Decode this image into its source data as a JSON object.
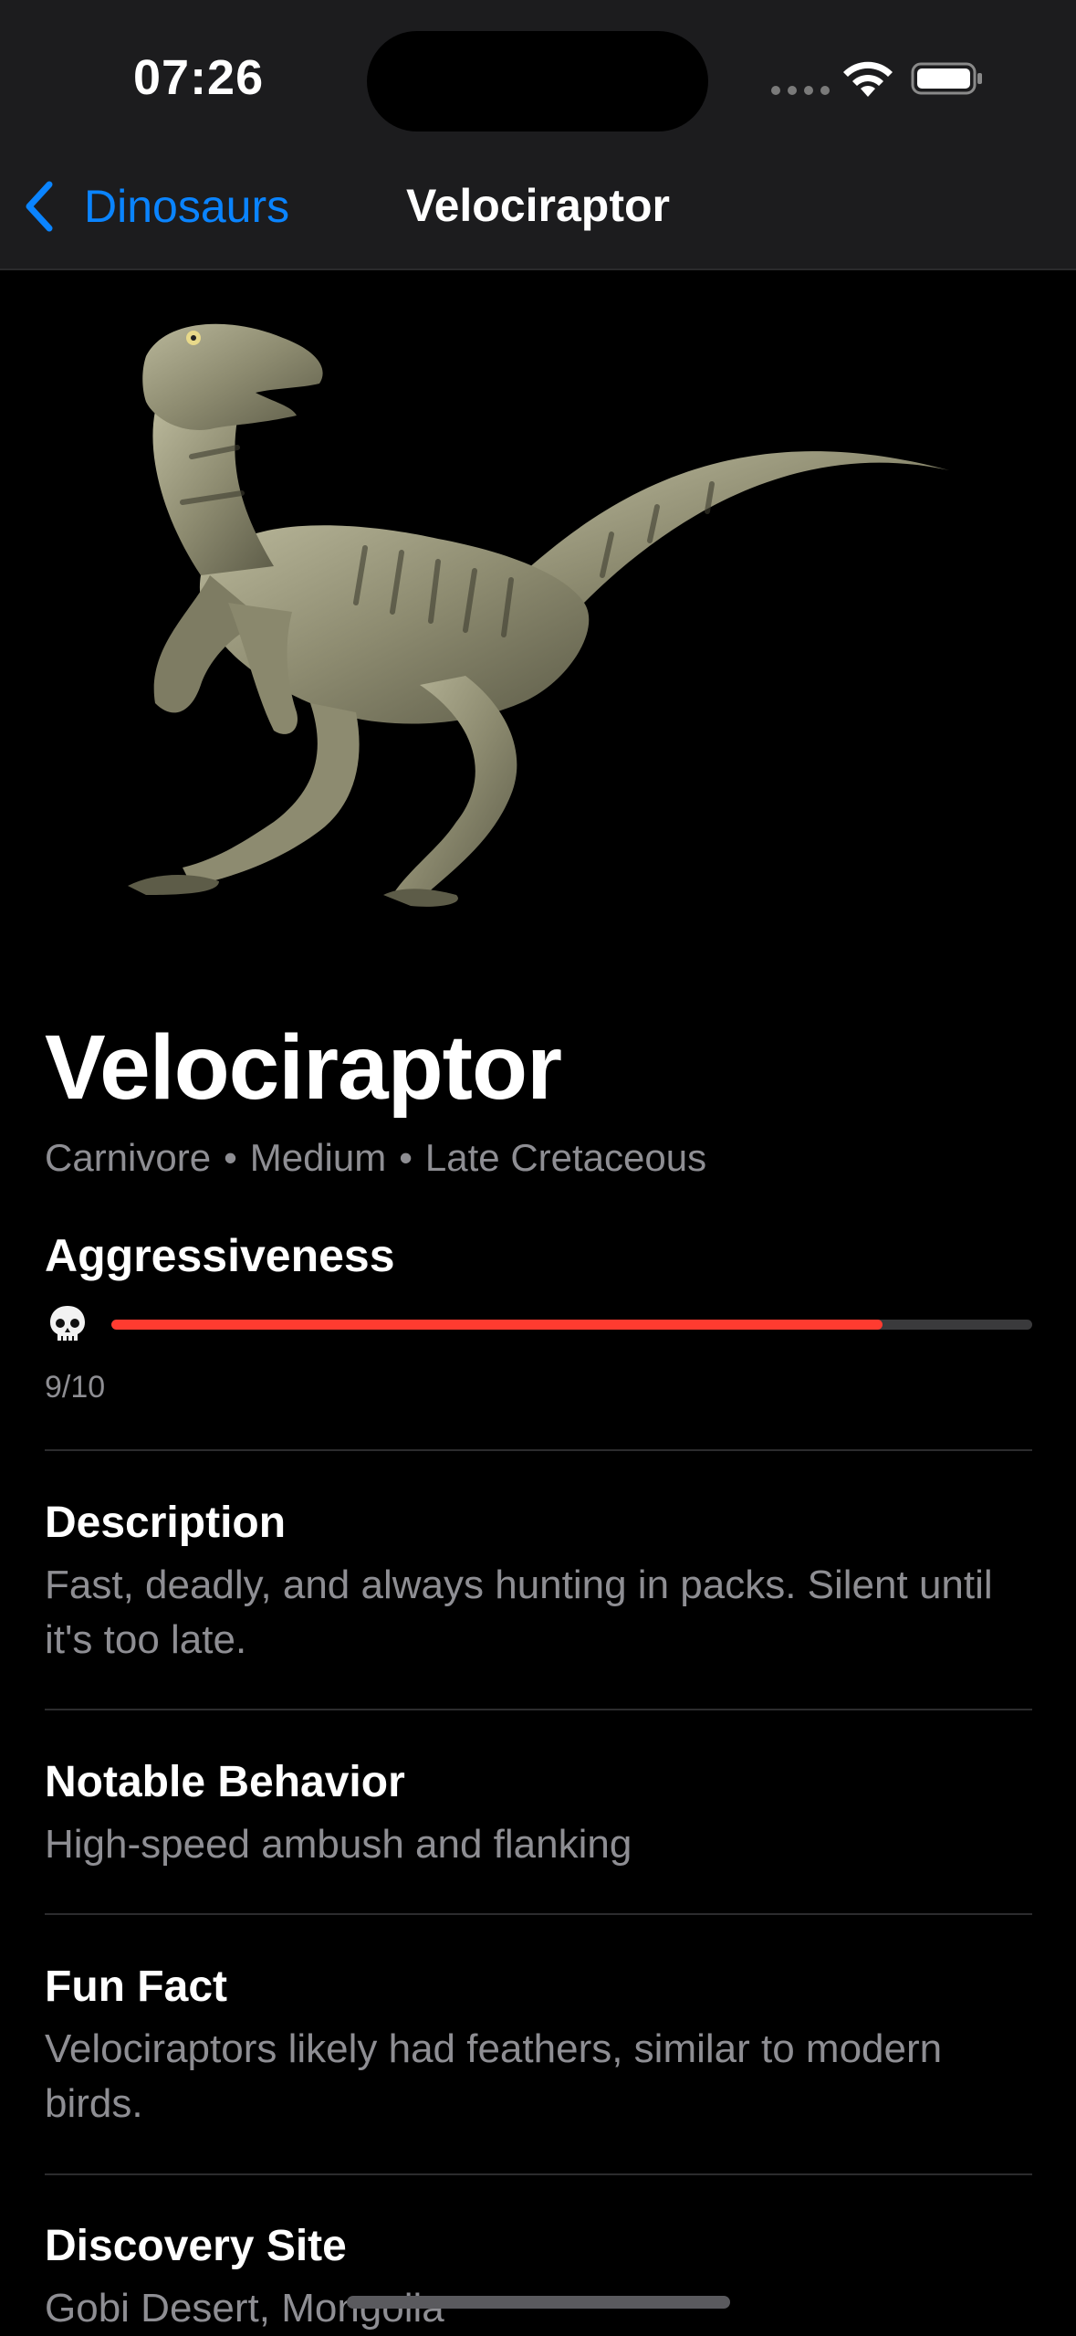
{
  "status_bar": {
    "time": "07:26"
  },
  "nav": {
    "back_label": "Dinosaurs",
    "title": "Velociraptor"
  },
  "dino": {
    "name": "Velociraptor",
    "diet": "Carnivore",
    "size": "Medium",
    "period": "Late Cretaceous",
    "separator": "•",
    "image_icon": "velociraptor-illustration"
  },
  "aggressiveness": {
    "label": "Aggressiveness",
    "icon": "skull-icon",
    "value": 9,
    "max": 10,
    "score_text": "9/10",
    "bar_color": "#ff3b30"
  },
  "sections": {
    "description": {
      "title": "Description",
      "body": "Fast, deadly, and always hunting in packs. Silent until it's too late."
    },
    "behavior": {
      "title": "Notable Behavior",
      "body": "High-speed ambush and flanking"
    },
    "fun_fact": {
      "title": "Fun Fact",
      "body": "Velociraptors likely had feathers, similar to modern birds."
    },
    "discovery": {
      "title": "Discovery Site",
      "body": "Gobi Desert, Mongolia"
    }
  },
  "colors": {
    "accent": "#0a84ff",
    "secondary_text": "#8e8e93"
  }
}
